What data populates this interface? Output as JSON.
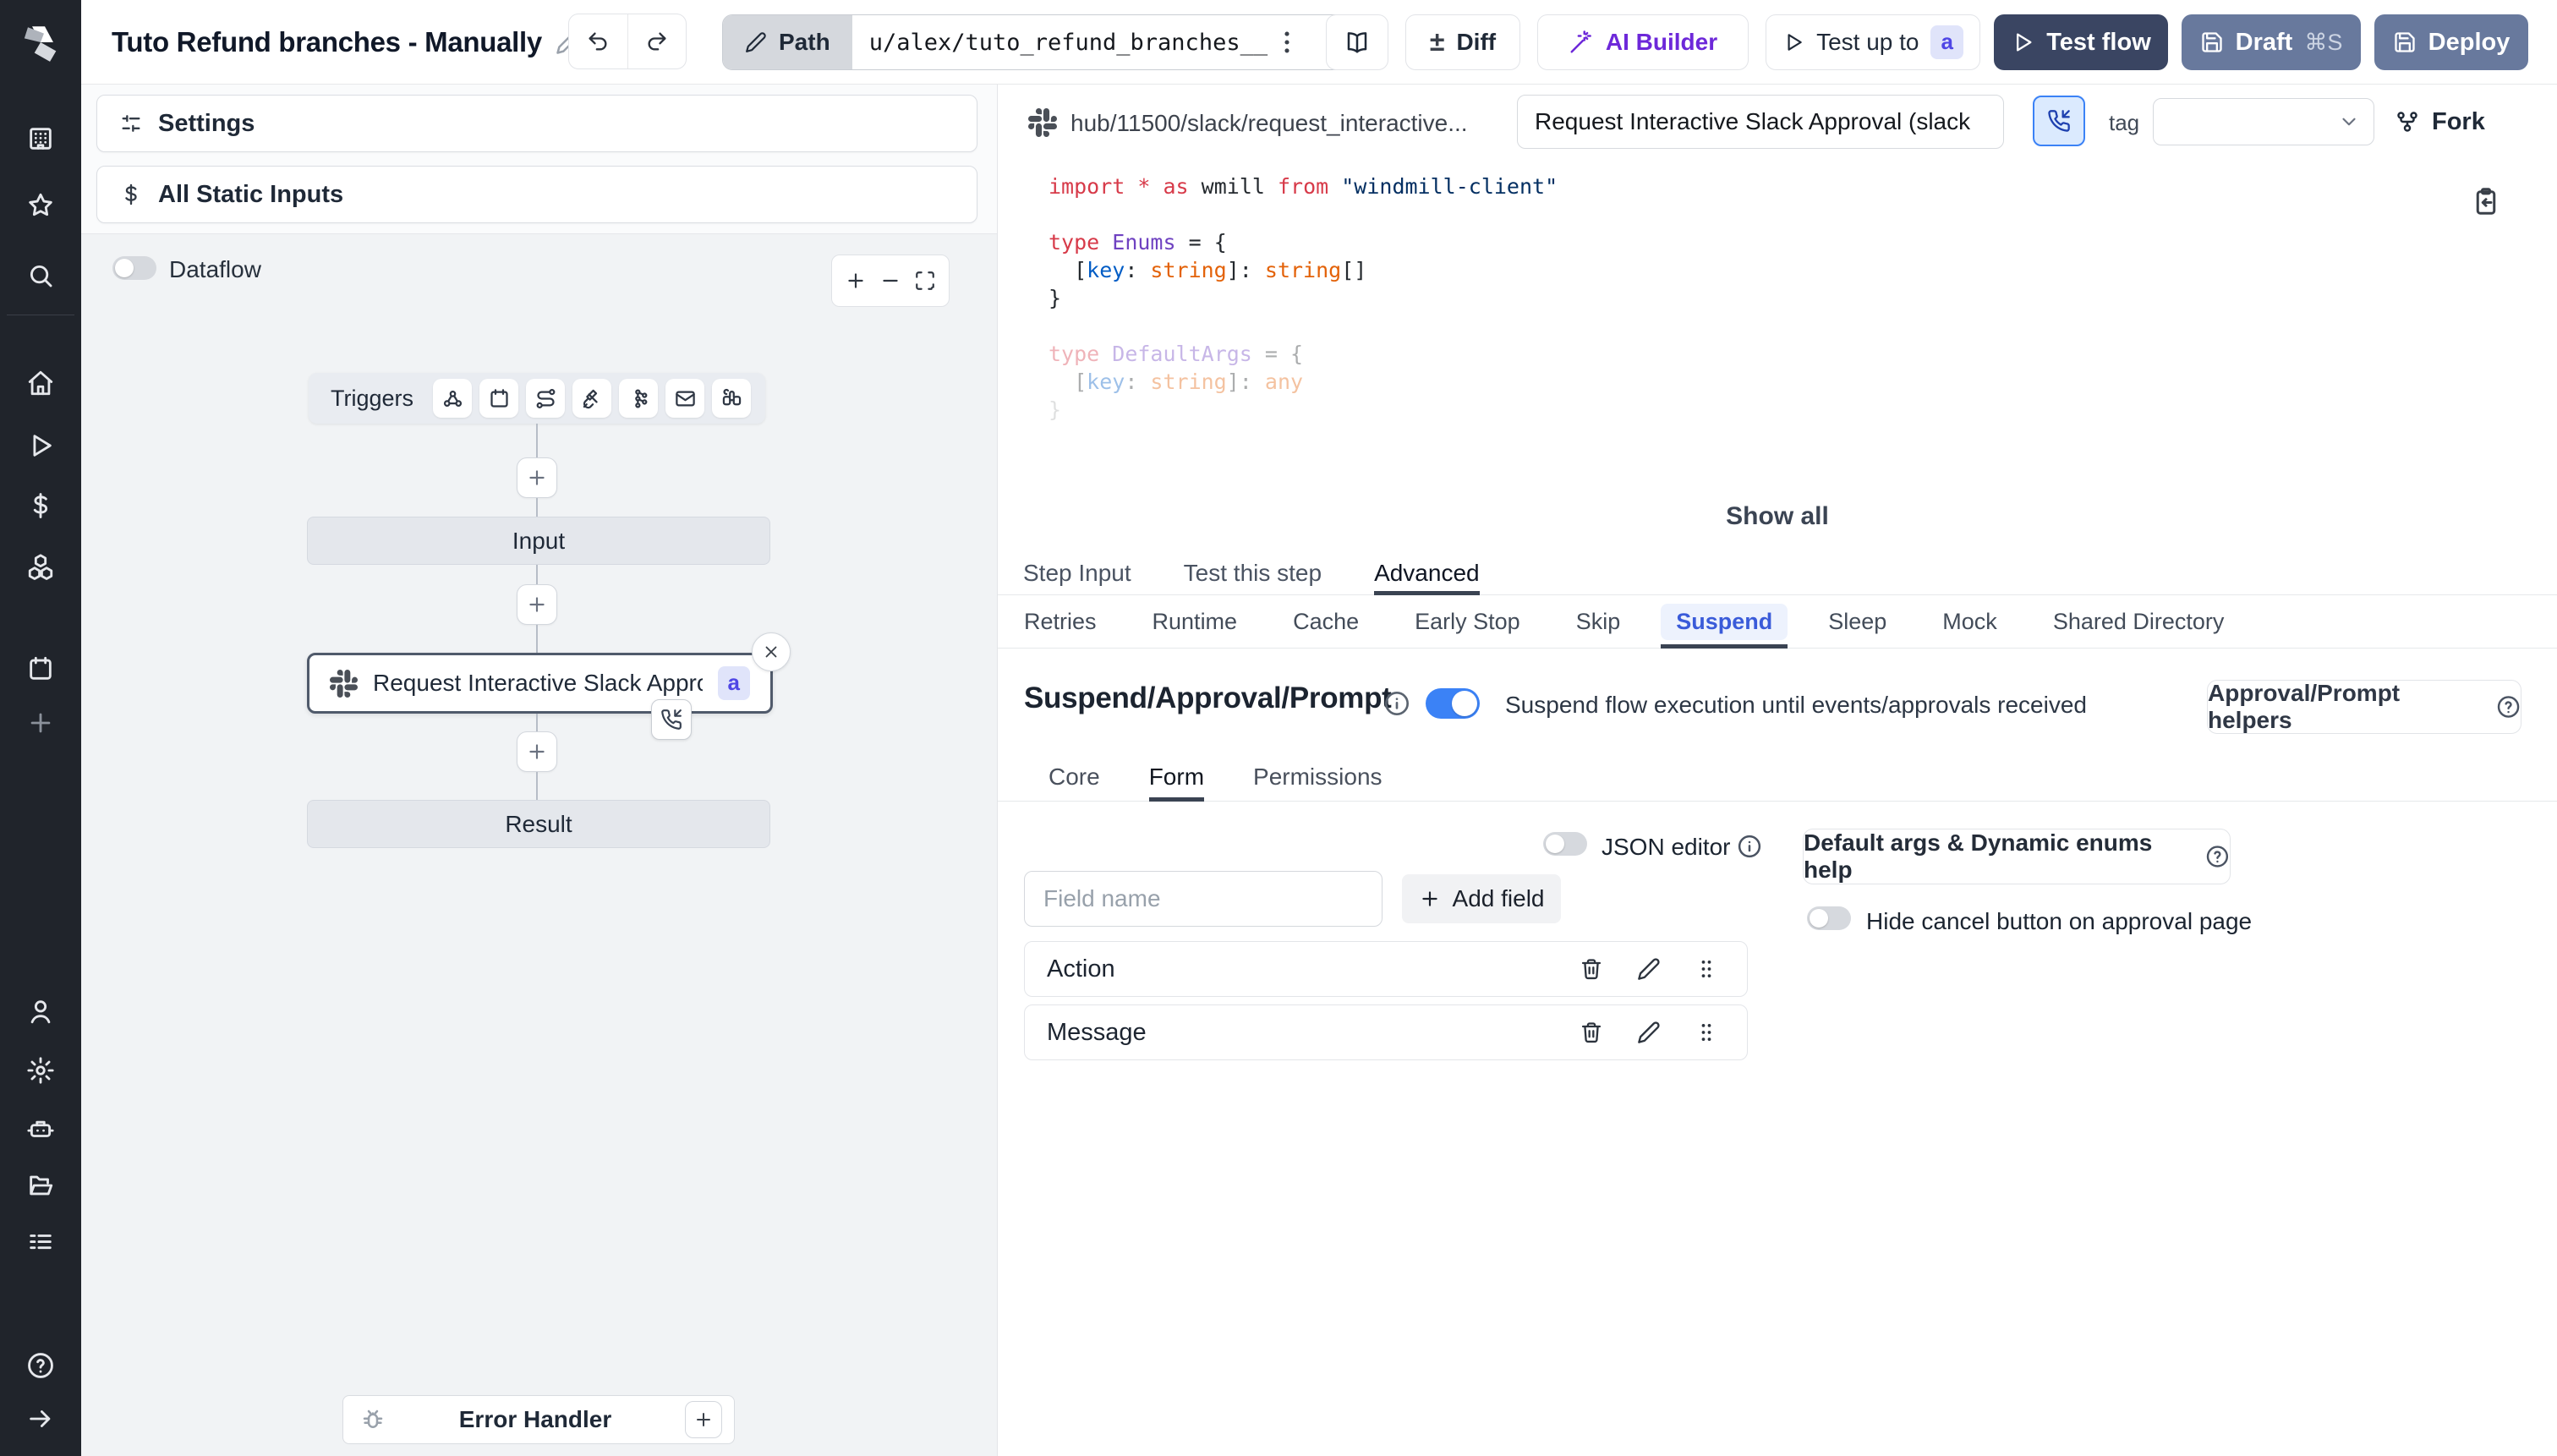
{
  "topbar": {
    "title": "Tuto Refund branches - Manually",
    "path_label": "Path",
    "path_value": "u/alex/tuto_refund_branches__",
    "diff_label": "Diff",
    "ai_builder_label": "AI Builder",
    "test_up_to_label": "Test up to",
    "test_up_to_badge": "a",
    "test_flow_label": "Test flow",
    "draft_label": "Draft",
    "draft_shortcut": "⌘S",
    "deploy_label": "Deploy"
  },
  "sidebar": {
    "top": [
      "buildings",
      "star",
      "search"
    ],
    "mid": [
      "home",
      "play",
      "dollar",
      "boxes"
    ],
    "sched": [
      "calendar",
      "plus"
    ],
    "bottom": [
      "user",
      "gear",
      "robot",
      "folder-open",
      "list-details"
    ],
    "foot": [
      "help-circle",
      "arrow-right"
    ]
  },
  "left_panel": {
    "settings_label": "Settings",
    "static_inputs_label": "All Static Inputs",
    "dataflow_label": "Dataflow",
    "flow": {
      "triggers_label": "Triggers",
      "trigger_icons": [
        "webhook",
        "calendar",
        "route",
        "plug",
        "broker",
        "mail",
        "binoculars"
      ],
      "input_label": "Input",
      "step_label": "Request Interactive Slack Approval (...",
      "step_badge": "a",
      "result_label": "Result",
      "error_handler_label": "Error Handler"
    }
  },
  "right_panel": {
    "hub_path": "hub/11500/slack/request_interactive...",
    "step_name": "Request Interactive Slack Approval (slack",
    "tag_label": "tag",
    "fork_label": "Fork",
    "show_all_label": "Show all",
    "tabs": [
      "Step Input",
      "Test this step",
      "Advanced"
    ],
    "tabs_active": "Advanced",
    "advanced_tabs": [
      "Retries",
      "Runtime",
      "Cache",
      "Early Stop",
      "Skip",
      "Suspend",
      "Sleep",
      "Mock",
      "Shared Directory"
    ],
    "advanced_active": "Suspend",
    "code_lines": [
      {
        "tokens": [
          [
            "import",
            "kw"
          ],
          [
            " ",
            "pl"
          ],
          [
            "*",
            "kw"
          ],
          [
            " ",
            "pl"
          ],
          [
            "as",
            "kw"
          ],
          [
            " wmill ",
            "pl"
          ],
          [
            "from",
            "kw"
          ],
          [
            " ",
            "pl"
          ],
          [
            "\"windmill-client\"",
            "str"
          ]
        ]
      },
      {
        "tokens": []
      },
      {
        "tokens": [
          [
            "type",
            "kw"
          ],
          [
            " ",
            "pl"
          ],
          [
            "Enums",
            "ty"
          ],
          [
            " = {",
            "pl"
          ]
        ]
      },
      {
        "tokens": [
          [
            "  [",
            "pl"
          ],
          [
            "key",
            "pr"
          ],
          [
            ": ",
            "pl"
          ],
          [
            "string",
            "or"
          ],
          [
            "]: ",
            "pl"
          ],
          [
            "string",
            "or"
          ],
          [
            "[]",
            "pl"
          ]
        ]
      },
      {
        "tokens": [
          [
            "}",
            "pl"
          ]
        ]
      },
      {
        "tokens": []
      },
      {
        "dim": 1,
        "tokens": [
          [
            "type",
            "kw"
          ],
          [
            " ",
            "pl"
          ],
          [
            "DefaultArgs",
            "ty"
          ],
          [
            " = {",
            "pl"
          ]
        ]
      },
      {
        "dim": 1,
        "tokens": [
          [
            "  [",
            "pl"
          ],
          [
            "key",
            "pr"
          ],
          [
            ": ",
            "pl"
          ],
          [
            "string",
            "or"
          ],
          [
            "]: ",
            "pl"
          ],
          [
            "any",
            "or"
          ]
        ]
      },
      {
        "dim": 2,
        "tokens": [
          [
            "}",
            "pl"
          ]
        ]
      }
    ],
    "suspend": {
      "title": "Suspend/Approval/Prompt",
      "toggle_label": "Suspend flow execution until events/approvals received",
      "toggle_on": true,
      "helpers_label": "Approval/Prompt helpers",
      "tabs": [
        "Core",
        "Form",
        "Permissions"
      ],
      "tabs_active": "Form",
      "json_editor_label": "JSON editor",
      "field_name_placeholder": "Field name",
      "add_field_label": "Add field",
      "default_args_label": "Default args & Dynamic enums help",
      "hide_cancel_label": "Hide cancel button on approval page",
      "fields": [
        "Action",
        "Message"
      ]
    }
  },
  "colors": {
    "accent_blue": "#3b82f6",
    "active_tab_blue": "#3a5bd9",
    "ai_purple": "#6d28d9",
    "badge_indigo_bg": "#e0e4fa",
    "badge_indigo_text": "#4f46e5",
    "test_flow_bg": "#3a4562",
    "deploy_bg": "#68799d",
    "sidebar_bg": "#20242b",
    "canvas_bg": "#f1f3f5"
  }
}
